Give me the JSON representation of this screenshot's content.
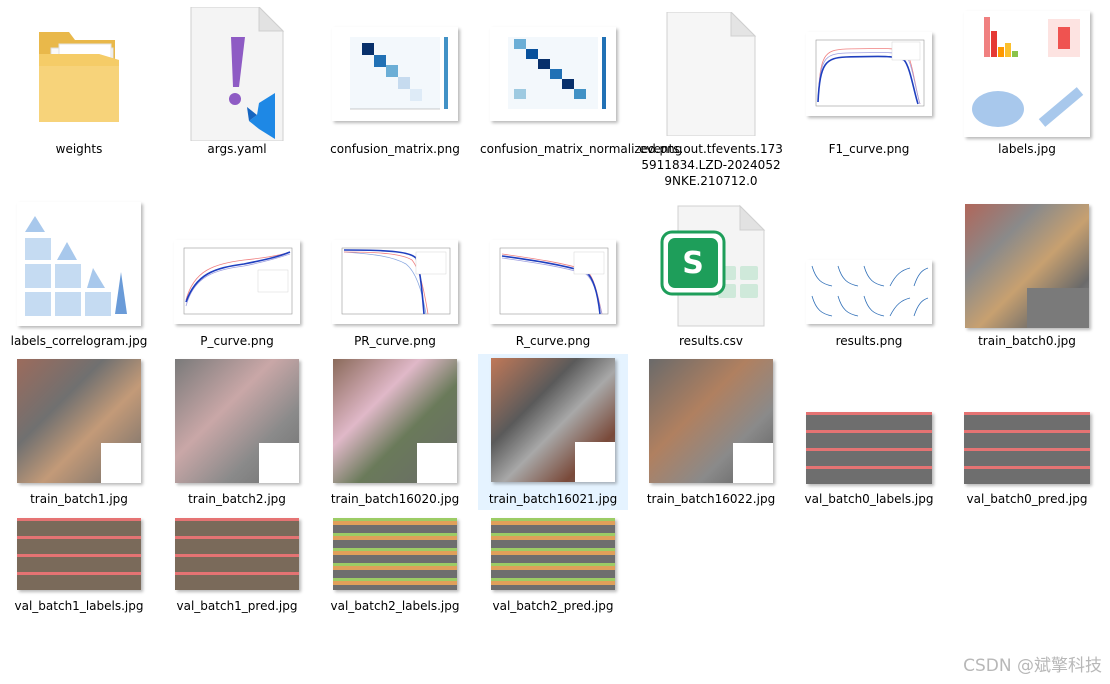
{
  "files": [
    {
      "name": "weights"
    },
    {
      "name": "args.yaml"
    },
    {
      "name": "confusion_matrix.png"
    },
    {
      "name": "confusion_matrix_normalized.png"
    },
    {
      "name": "events.out.tfevents.1735911834.LZD-20240529NKE.210712.0"
    },
    {
      "name": "F1_curve.png"
    },
    {
      "name": "labels.jpg"
    },
    {
      "name": "labels_correlogram.jpg"
    },
    {
      "name": "P_curve.png"
    },
    {
      "name": "PR_curve.png"
    },
    {
      "name": "R_curve.png"
    },
    {
      "name": "results.csv"
    },
    {
      "name": "results.png"
    },
    {
      "name": "train_batch0.jpg"
    },
    {
      "name": "train_batch1.jpg"
    },
    {
      "name": "train_batch2.jpg"
    },
    {
      "name": "train_batch16020.jpg"
    },
    {
      "name": "train_batch16021.jpg"
    },
    {
      "name": "train_batch16022.jpg"
    },
    {
      "name": "val_batch0_labels.jpg"
    },
    {
      "name": "val_batch0_pred.jpg"
    },
    {
      "name": "val_batch1_labels.jpg"
    },
    {
      "name": "val_batch1_pred.jpg"
    },
    {
      "name": "val_batch2_labels.jpg"
    },
    {
      "name": "val_batch2_pred.jpg"
    }
  ],
  "colors": {
    "selection": "#e5f3ff",
    "folder": "#f3c85a",
    "csv_green": "#1e9e5a",
    "vscode_blue": "#1e88e5",
    "yaml_purple": "#8e5bc4"
  },
  "watermark": "CSDN @斌擎科技"
}
